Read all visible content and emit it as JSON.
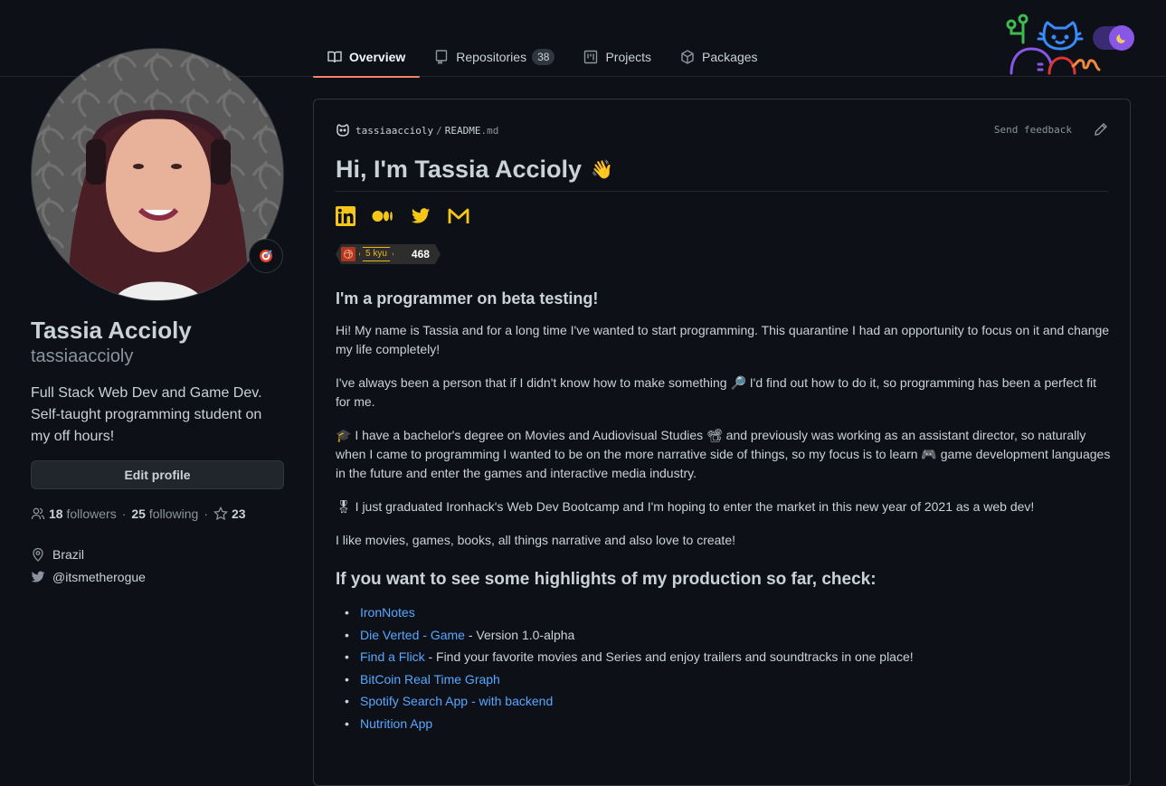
{
  "tabs": [
    {
      "label": "Overview",
      "icon": "book-icon",
      "active": true
    },
    {
      "label": "Repositories",
      "icon": "repo-icon",
      "count": "38"
    },
    {
      "label": "Projects",
      "icon": "project-icon"
    },
    {
      "label": "Packages",
      "icon": "package-icon"
    }
  ],
  "theme_toggle": {
    "state": "dark",
    "icon": "moon-icon"
  },
  "profile": {
    "name": "Tassia Accioly",
    "login": "tassiaaccioly",
    "bio": "Full Stack Web Dev and Game Dev. Self-taught programming student on my off hours!",
    "status_emoji": "🎯",
    "edit_label": "Edit profile",
    "followers": "18",
    "followers_label": "followers",
    "following": "25",
    "following_label": "following",
    "stars": "23",
    "location": "Brazil",
    "twitter": "@itsmetherogue"
  },
  "readme": {
    "owner": "tassiaaccioly",
    "separator": "/",
    "file": "README",
    "ext": ".md",
    "feedback": "Send feedback",
    "title": "Hi, I'm Tassia Accioly",
    "title_emoji": "👋",
    "social": [
      "linkedin-icon",
      "medium-icon",
      "twitter-icon",
      "gmail-icon"
    ],
    "badge": {
      "rank": "5 kyu",
      "score": "468"
    },
    "subtitle": "I'm a programmer on beta testing!",
    "paragraphs": [
      "Hi! My name is Tassia and for a long time I've wanted to start programming. This quarantine I had an opportunity to focus on it and change my life completely!",
      "I've always been a person that if I didn't know how to make something 🔎 I'd find out how to do it, so programming has been a perfect fit for me.",
      "🎓 I have a bachelor's degree on Movies and Audiovisual Studies 📽 and previously was working as an assistant director, so naturally when I came to programming I wanted to be on the more narrative side of things, so my focus is to learn 🎮 game development languages in the future and enter the games and interactive media industry.",
      "🎖 I just graduated Ironhack's Web Dev Bootcamp and I'm hoping to enter the market in this new year of 2021 as a web dev!",
      "I like movies, games, books, all things narrative and also love to create!"
    ],
    "highlights_title": "If you want to see some highlights of my production so far, check:",
    "highlights": [
      {
        "link": "IronNotes",
        "rest": ""
      },
      {
        "link": "Die Verted - Game",
        "rest": " - Version 1.0-alpha"
      },
      {
        "link": "Find a Flick",
        "rest": " - Find your favorite movies and Series and enjoy trailers and soundtracks in one place!"
      },
      {
        "link": "BitCoin Real Time Graph",
        "rest": ""
      },
      {
        "link": "Spotify Search App - with backend",
        "rest": ""
      },
      {
        "link": "Nutrition App",
        "rest": ""
      }
    ]
  }
}
